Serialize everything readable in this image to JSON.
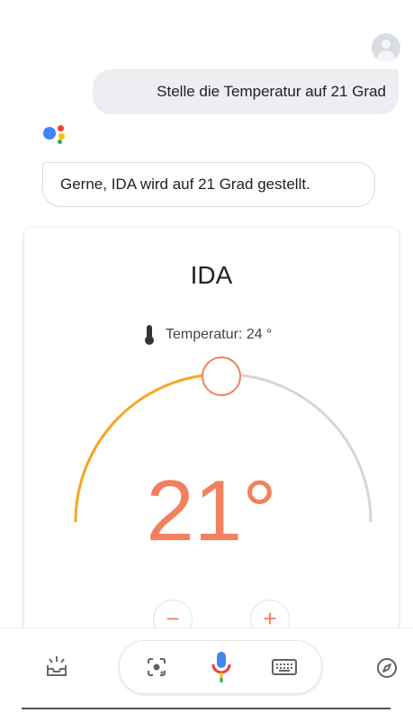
{
  "conversation": {
    "user_message": "Stelle die Temperatur auf 21 Grad",
    "assistant_message": "Gerne, IDA wird auf 21 Grad gestellt."
  },
  "thermostat": {
    "name": "IDA",
    "current_label": "Temperatur: 24 °",
    "target_display": "21°",
    "target_value": 21,
    "current_value": 24,
    "minus_label": "−",
    "plus_label": "+"
  },
  "colors": {
    "accent_orange": "#f2805f",
    "arc_active": "#f5a623",
    "arc_inactive": "#d6d6d6",
    "google_blue": "#4285f4",
    "google_red": "#ea4335",
    "google_yellow": "#fbbc05",
    "google_green": "#34a853"
  },
  "icons": {
    "avatar": "account-icon",
    "assistant": "google-assistant-icon",
    "thermometer": "thermometer-icon",
    "updates": "inbox-sparkle-icon",
    "lens": "lens-icon",
    "mic": "microphone-icon",
    "keyboard": "keyboard-icon",
    "explore": "compass-icon"
  }
}
